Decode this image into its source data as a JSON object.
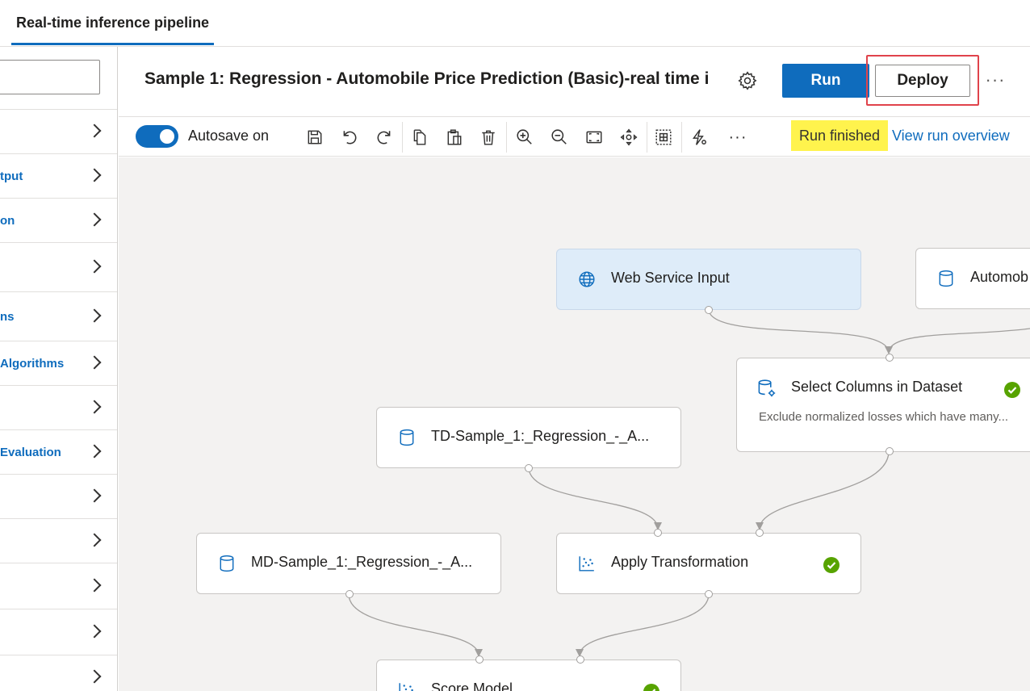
{
  "tabs": {
    "active": "Real-time inference pipeline"
  },
  "left_panel": {
    "search_placeholder": "",
    "categories": [
      {
        "label": ""
      },
      {
        "label": "tput"
      },
      {
        "label": "on"
      },
      {
        "label": ""
      },
      {
        "label": "ns"
      },
      {
        "label": " Algorithms"
      },
      {
        "label": ""
      },
      {
        "label": "Evaluation"
      },
      {
        "label": ""
      },
      {
        "label": ""
      },
      {
        "label": ""
      },
      {
        "label": ""
      },
      {
        "label": ""
      }
    ]
  },
  "header": {
    "title": "Sample 1: Regression - Automobile Price Prediction (Basic)-real time i...",
    "run_label": "Run",
    "deploy_label": "Deploy",
    "more_label": "···"
  },
  "toolbar": {
    "autosave_label": "Autosave on",
    "autosave_on": true,
    "icons": [
      "save-icon",
      "undo-icon",
      "redo-icon",
      "copy-icon",
      "paste-icon",
      "delete-icon",
      "zoom-in-icon",
      "zoom-out-icon",
      "fit-to-screen-icon",
      "pan-icon",
      "select-region-icon",
      "auto-layout-icon",
      "more-icon"
    ],
    "more_label": "···",
    "status": "Run finished",
    "status_color": "#fff34d",
    "view_run_link": "View run overview"
  },
  "canvas": {
    "nodes": [
      {
        "id": "web-service-input",
        "label": "Web Service Input",
        "icon": "globe-icon",
        "selected": true,
        "completed": false
      },
      {
        "id": "automobile-dataset",
        "label": "Automob",
        "icon": "database-icon",
        "selected": false,
        "completed": false
      },
      {
        "id": "select-columns",
        "label": "Select Columns in Dataset",
        "subtitle": "Exclude normalized losses which have many...",
        "icon": "dataset-settings-icon",
        "selected": false,
        "completed": true
      },
      {
        "id": "td-sample",
        "label": "TD-Sample_1:_Regression_-_A...",
        "icon": "database-icon",
        "selected": false,
        "completed": false
      },
      {
        "id": "apply-transformation",
        "label": "Apply Transformation",
        "icon": "scatter-icon",
        "selected": false,
        "completed": true
      },
      {
        "id": "md-sample",
        "label": "MD-Sample_1:_Regression_-_A...",
        "icon": "database-icon",
        "selected": false,
        "completed": false
      },
      {
        "id": "score-model",
        "label": "Score Model",
        "icon": "scatter-icon",
        "selected": false,
        "completed": true
      }
    ]
  },
  "colors": {
    "accent": "#0f6cbd",
    "success": "#57a300",
    "highlight_border": "#e0434b",
    "canvas_bg": "#f3f2f1"
  }
}
